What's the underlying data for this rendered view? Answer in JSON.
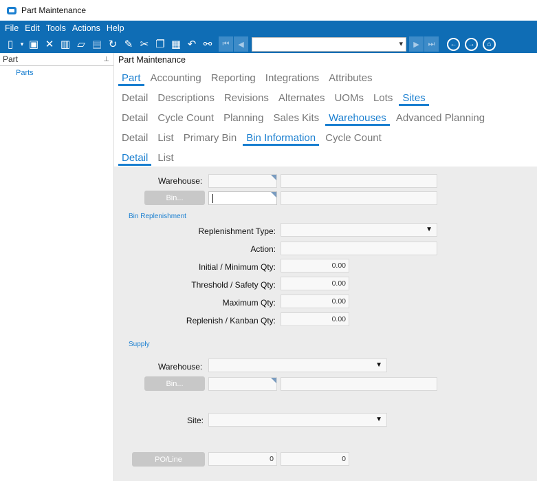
{
  "window": {
    "title": "Part Maintenance"
  },
  "menu": [
    "File",
    "Edit",
    "Tools",
    "Actions",
    "Help"
  ],
  "sidebar": {
    "header": "Part",
    "items": [
      "Parts"
    ]
  },
  "main": {
    "title": "Part Maintenance"
  },
  "tabs": {
    "row1": [
      "Part",
      "Accounting",
      "Reporting",
      "Integrations",
      "Attributes"
    ],
    "row2": [
      "Detail",
      "Descriptions",
      "Revisions",
      "Alternates",
      "UOMs",
      "Lots",
      "Sites"
    ],
    "row3": [
      "Detail",
      "Cycle Count",
      "Planning",
      "Sales Kits",
      "Warehouses",
      "Advanced Planning"
    ],
    "row4": [
      "Detail",
      "List",
      "Primary Bin",
      "Bin Information",
      "Cycle Count"
    ],
    "row5": [
      "Detail",
      "List"
    ]
  },
  "form": {
    "warehouse_label": "Warehouse:",
    "bin_button": "Bin...",
    "bin_replenishment_section": "Bin Replenishment",
    "replenishment_type_label": "Replenishment Type:",
    "action_label": "Action:",
    "initial_min_label": "Initial / Minimum Qty:",
    "initial_min_value": "0.00",
    "threshold_label": "Threshold / Safety Qty:",
    "threshold_value": "0.00",
    "maximum_label": "Maximum Qty:",
    "maximum_value": "0.00",
    "replenish_label": "Replenish / Kanban Qty:",
    "replenish_value": "0.00",
    "supply_section": "Supply",
    "supply_warehouse_label": "Warehouse:",
    "supply_bin_button": "Bin...",
    "site_label": "Site:",
    "po_line_button": "PO/Line",
    "po_value": "0",
    "line_value": "0"
  },
  "colors": {
    "accent": "#1a7fd0",
    "toolbar": "#0f6db5",
    "panel": "#ececec"
  }
}
